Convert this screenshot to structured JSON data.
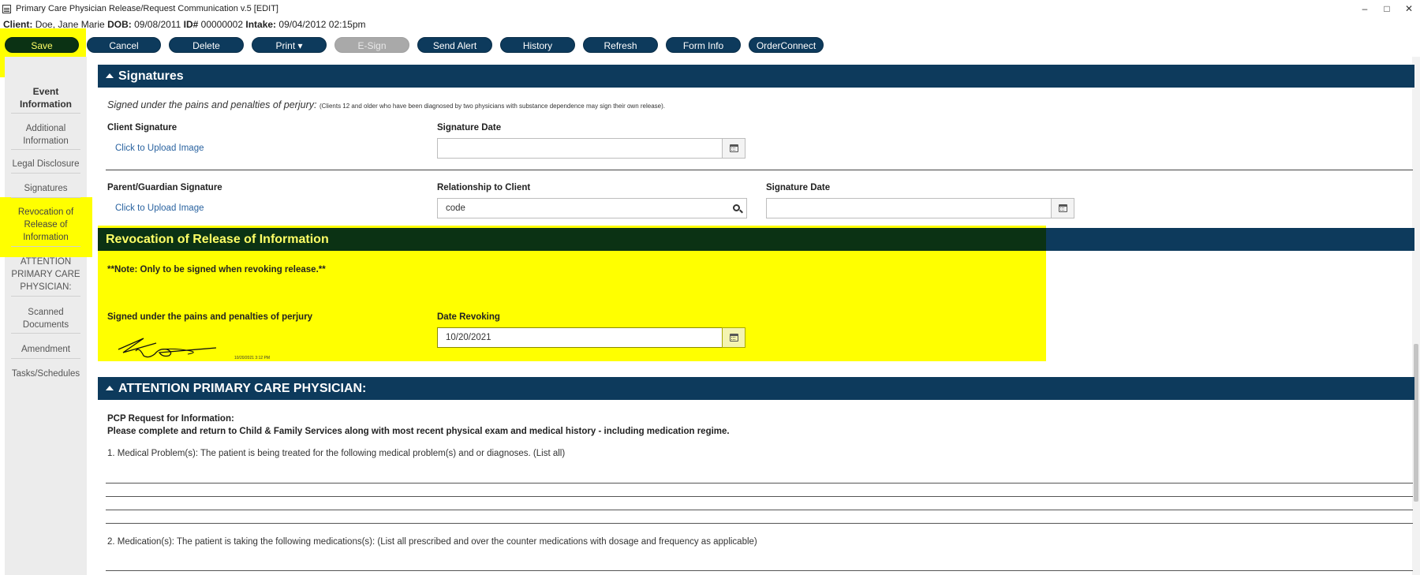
{
  "window": {
    "title": "Primary Care Physician Release/Request Communication v.5 [EDIT]",
    "controls": [
      "–",
      "□",
      "✕"
    ]
  },
  "client": {
    "label_client": "Client:",
    "name": "Doe, Jane Marie",
    "label_dob": "DOB:",
    "dob": "09/08/2011",
    "label_id": "ID#",
    "id": "00000002",
    "label_intake": "Intake:",
    "intake": "09/04/2012 02:15pm"
  },
  "toolbar": {
    "save": "Save",
    "cancel": "Cancel",
    "delete": "Delete",
    "print": "Print ▾",
    "esign": "E-Sign",
    "send_alert": "Send Alert",
    "history": "History",
    "refresh": "Refresh",
    "form_info": "Form Info",
    "order_connect": "OrderConnect"
  },
  "nav": {
    "event_info": "Event Information",
    "additional": "Additional Information",
    "legal": "Legal Disclosure",
    "signatures": "Signatures",
    "revocation": "Revocation of Release of Information",
    "attention": "ATTENTION PRIMARY CARE PHYSICIAN:",
    "scanned": "Scanned Documents",
    "amendment": "Amendment",
    "tasks": "Tasks/Schedules"
  },
  "signatures": {
    "title": "Signatures",
    "perjury_main": "Signed under the pains and penalties of perjury:",
    "perjury_note": "(Clients 12 and older who have been diagnosed by two physicians with substance dependence may sign their own release).",
    "client_signature": "Client Signature",
    "upload1": "Click to Upload Image",
    "signature_date": "Signature Date",
    "signature_date_value": "",
    "guardian_signature": "Parent/Guardian Signature",
    "upload2": "Click to Upload Image",
    "relationship": "Relationship to Client",
    "relationship_value": "code",
    "signature_date2": "Signature Date",
    "signature_date2_value": ""
  },
  "revocation": {
    "title": "Revocation of Release of Information",
    "note": "**Note: Only to be signed when revoking release.**",
    "perjury": "Signed under the pains and penalties of perjury",
    "date_revoking": "Date Revoking",
    "date_revoking_value": "10/20/2021",
    "sig_timestamp": "10/20/2021 3:12 PM"
  },
  "attention": {
    "title": "ATTENTION PRIMARY CARE PHYSICIAN:",
    "pcp_request": "PCP Request for Information:",
    "instructions": "Please complete and return to Child & Family Services along with most recent physical exam and medical history -  including medication regime.",
    "q1": "1.  Medical Problem(s): The patient is being treated for the following medical problem(s) and or diagnoses. (List all)",
    "q2": "2.  Medication(s): The patient is taking the following medications(s): (List all prescribed and over the counter medications with dosage and frequency as applicable)"
  }
}
